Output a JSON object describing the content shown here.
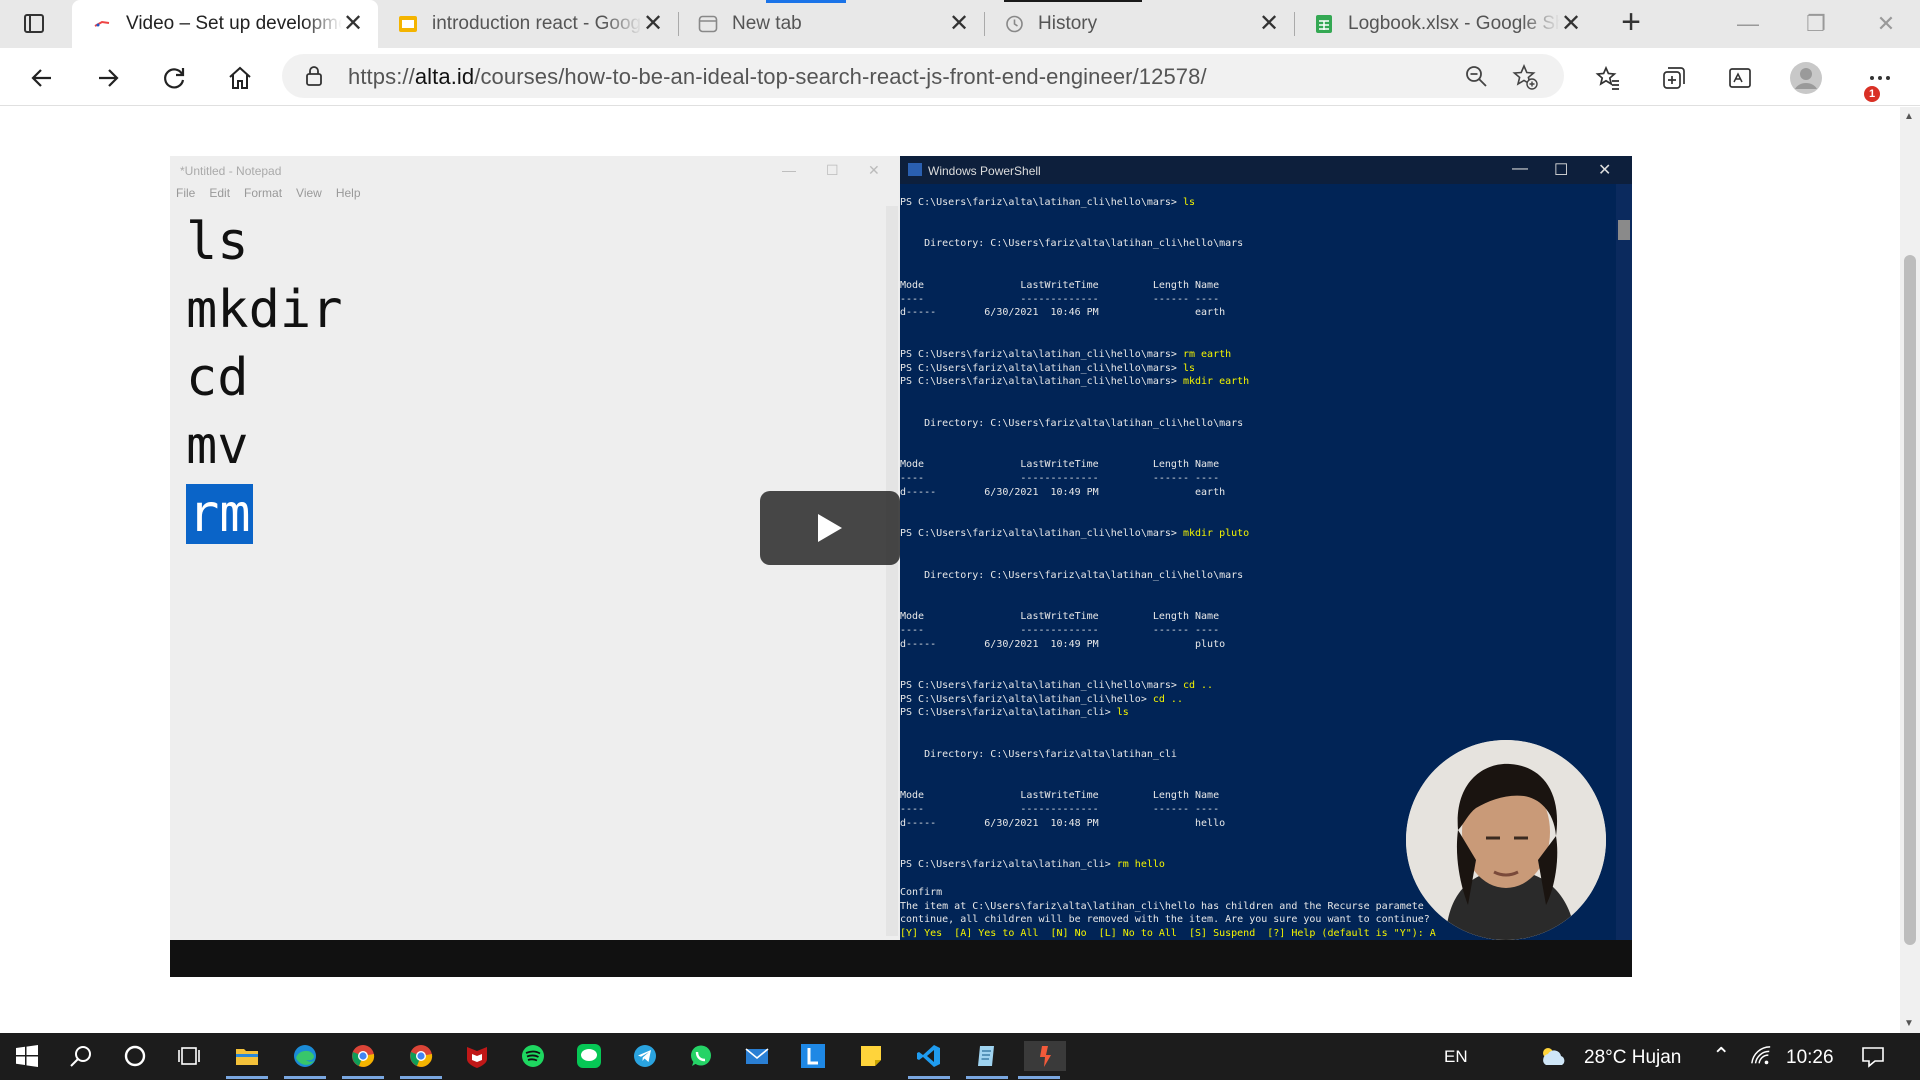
{
  "browser": {
    "tabs": [
      {
        "label": "Video – Set up development environment",
        "favicon": "alta-icon",
        "active": true
      },
      {
        "label": "introduction react - Google Slides",
        "favicon": "slides-icon",
        "active": false
      },
      {
        "label": "New tab",
        "favicon": "newtab-icon",
        "active": false
      },
      {
        "label": "History",
        "favicon": "history-icon",
        "active": false
      },
      {
        "label": "Logbook.xlsx - Google Sheets",
        "favicon": "sheets-icon",
        "active": false
      }
    ],
    "address": {
      "scheme": "https://",
      "host": "alta.id",
      "path": "/courses/how-to-be-an-ideal-top-search-react-js-front-end-engineer/12578/"
    },
    "notification_badge": "1"
  },
  "video": {
    "notepad": {
      "title": "*Untitled - Notepad",
      "menu": [
        "File",
        "Edit",
        "Format",
        "View",
        "Help"
      ],
      "lines": [
        "ls",
        "mkdir",
        "cd",
        "mv"
      ],
      "selected_line": "rm"
    },
    "powershell": {
      "title": "Windows PowerShell",
      "lines": [
        "PS C:\\Users\\fariz\\alta\\latihan_cli\\hello\\mars> ls",
        "",
        "",
        "    Directory: C:\\Users\\fariz\\alta\\latihan_cli\\hello\\mars",
        "",
        "",
        "Mode                LastWriteTime         Length Name",
        "----                -------------         ------ ----",
        "d-----        6/30/2021  10:46 PM                earth",
        "",
        "",
        "PS C:\\Users\\fariz\\alta\\latihan_cli\\hello\\mars> rm earth",
        "PS C:\\Users\\fariz\\alta\\latihan_cli\\hello\\mars> ls",
        "PS C:\\Users\\fariz\\alta\\latihan_cli\\hello\\mars> mkdir earth",
        "",
        "",
        "    Directory: C:\\Users\\fariz\\alta\\latihan_cli\\hello\\mars",
        "",
        "",
        "Mode                LastWriteTime         Length Name",
        "----                -------------         ------ ----",
        "d-----        6/30/2021  10:49 PM                earth",
        "",
        "",
        "PS C:\\Users\\fariz\\alta\\latihan_cli\\hello\\mars> mkdir pluto",
        "",
        "",
        "    Directory: C:\\Users\\fariz\\alta\\latihan_cli\\hello\\mars",
        "",
        "",
        "Mode                LastWriteTime         Length Name",
        "----                -------------         ------ ----",
        "d-----        6/30/2021  10:49 PM                pluto",
        "",
        "",
        "PS C:\\Users\\fariz\\alta\\latihan_cli\\hello\\mars> cd ..",
        "PS C:\\Users\\fariz\\alta\\latihan_cli\\hello> cd ..",
        "PS C:\\Users\\fariz\\alta\\latihan_cli> ls",
        "",
        "",
        "    Directory: C:\\Users\\fariz\\alta\\latihan_cli",
        "",
        "",
        "Mode                LastWriteTime         Length Name",
        "----                -------------         ------ ----",
        "d-----        6/30/2021  10:48 PM                hello",
        "",
        "",
        "PS C:\\Users\\fariz\\alta\\latihan_cli> rm hello",
        "",
        "Confirm",
        "The item at C:\\Users\\fariz\\alta\\latihan_cli\\hello has children and the Recurse paramete",
        "continue, all children will be removed with the item. Are you sure you want to continue?",
        "[Y] Yes  [A] Yes to All  [N] No  [L] No to All  [S] Suspend  [?] Help (default is \"Y\"): A"
      ]
    }
  },
  "taskbar": {
    "apps": [
      "windows-start-icon",
      "search-icon",
      "cortana-icon",
      "task-view-icon",
      "file-explorer-icon",
      "edge-icon",
      "chrome-icon",
      "chrome-icon",
      "mcafee-icon",
      "spotify-icon",
      "line-icon",
      "telegram-icon",
      "whatsapp-icon",
      "mail-icon",
      "l-app-icon",
      "sticky-notes-icon",
      "vscode-icon",
      "notepad-icon",
      "app-icon"
    ],
    "language": "EN",
    "weather": "28°C  Hujan",
    "time": "10:26"
  }
}
